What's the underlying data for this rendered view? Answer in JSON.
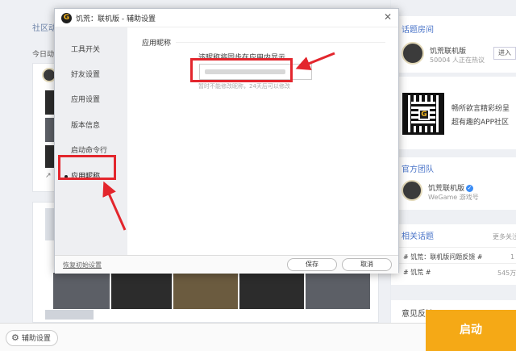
{
  "background": {
    "left_header": "社区动",
    "left_sub": "今日动",
    "share_icon": "share-icon",
    "right": {
      "topic_title": "话题房间",
      "topic_name": "饥荒联机版",
      "topic_stats": "50004 人正在热议",
      "topic_follow": "进入",
      "promo_line1": "畅所欲言精彩纷呈",
      "promo_line2": "超有趣的APP社区",
      "team_title": "官方团队",
      "team_name": "饥荒联机版",
      "team_sub": "WeGame 游戏号",
      "related_title": "相关话题",
      "related_more": "更多关注",
      "related_items": [
        {
          "label": "# 饥荒：联机版问题反馈 #",
          "count": "1"
        },
        {
          "label": "# 饥荒 #",
          "count": "545万"
        }
      ],
      "feedback_title": "意见反馈"
    }
  },
  "bottombar": {
    "assist_label": "辅助设置",
    "launch_label": "启动"
  },
  "dialog": {
    "title": "饥荒：联机版 - 辅助设置",
    "nav": [
      "工具开关",
      "好友设置",
      "应用设置",
      "版本信息",
      "启动命令行",
      "应用昵称"
    ],
    "section_title": "应用昵称",
    "nickname_label": "该昵称将同步在应用内显示",
    "nickname_value": "",
    "nickname_hint": "暂时不能修改昵称，24天后可以修改",
    "reset_label": "恢复初始设置",
    "save_label": "保存",
    "cancel_label": "取消"
  },
  "colors": {
    "highlight": "#e3262d",
    "launch": "#f5a916",
    "link": "#4a74c8"
  }
}
